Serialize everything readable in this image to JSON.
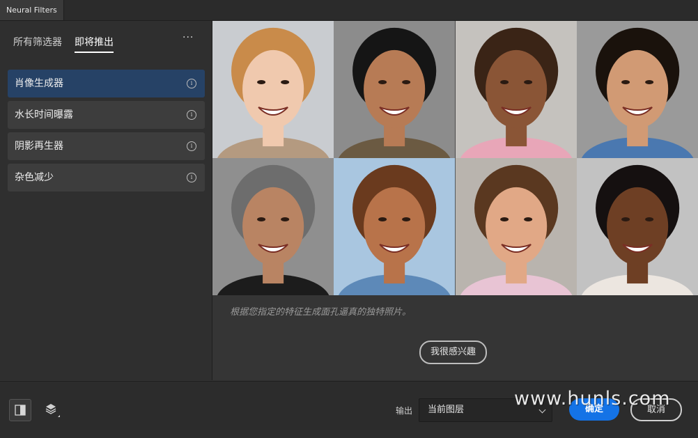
{
  "window": {
    "title": "Neural Filters"
  },
  "sidebar": {
    "tabs": [
      {
        "label": "所有筛选器",
        "active": false
      },
      {
        "label": "即将推出",
        "active": true
      }
    ],
    "more_label": "···",
    "items": [
      {
        "label": "肖像生成器",
        "selected": true,
        "icon": "info-icon"
      },
      {
        "label": "水长时间曝露",
        "selected": false,
        "icon": "info-icon"
      },
      {
        "label": "阴影再生器",
        "selected": false,
        "icon": "info-icon"
      },
      {
        "label": "杂色减少",
        "selected": false,
        "icon": "info-icon"
      }
    ],
    "info_glyph": "i"
  },
  "main": {
    "faces": [
      {
        "bg": "#c9ccd0",
        "skin": "#f0c9ae",
        "hair": "#c98b4a",
        "shirt": "#b49a80"
      },
      {
        "bg": "#8c8c8c",
        "skin": "#b77b55",
        "hair": "#151515",
        "shirt": "#6b5a42"
      },
      {
        "bg": "#c5c2be",
        "skin": "#8a5536",
        "hair": "#3a2416",
        "shirt": "#e8a6b8"
      },
      {
        "bg": "#9a9a9a",
        "skin": "#d19a74",
        "hair": "#1a120c",
        "shirt": "#4a78b0"
      },
      {
        "bg": "#8f8f8f",
        "skin": "#b98463",
        "hair": "#6d6d6d",
        "shirt": "#1c1c1c"
      },
      {
        "bg": "#a9c6e0",
        "skin": "#b8734a",
        "hair": "#6a3a1e",
        "shirt": "#5d89b8"
      },
      {
        "bg": "#b9b4ae",
        "skin": "#e1a886",
        "hair": "#5a3820",
        "shirt": "#e8c4d4"
      },
      {
        "bg": "#c2c2c2",
        "skin": "#6e3f24",
        "hair": "#151010",
        "shirt": "#ece6e0"
      }
    ],
    "description": "根据您指定的特征生成面孔逼真的独特照片。",
    "interest_button": "我很感兴趣"
  },
  "footer": {
    "compare_icon": "compare-icon",
    "layers_icon": "layers-icon",
    "output_label": "输出",
    "output_value": "当前图层",
    "ok_label": "确定",
    "cancel_label": "取消",
    "accent": "#1473e6"
  },
  "watermark": "www.hunls.com"
}
